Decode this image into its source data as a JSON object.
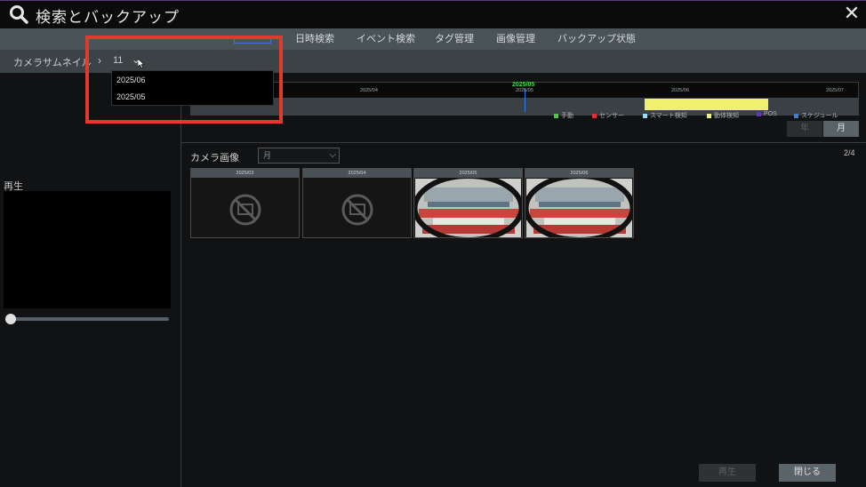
{
  "window": {
    "title": "検索とバックアップ",
    "close_label": "✕"
  },
  "tabs": [
    {
      "label": "日時検索"
    },
    {
      "label": "イベント検索"
    },
    {
      "label": "タグ管理"
    },
    {
      "label": "画像管理"
    },
    {
      "label": "バックアップ状態"
    }
  ],
  "breadcrumb": {
    "label": "カメラサムネイル",
    "arrow": "›",
    "value": "11",
    "chevron": "⌄"
  },
  "dropdown": {
    "options": [
      "2025/06",
      "2025/05"
    ]
  },
  "left": {
    "play_label": "再生"
  },
  "timeline": {
    "current": "2025/05",
    "ticks": [
      "2025/04",
      "2025/05",
      "2025/06",
      "2025/07"
    ],
    "legend": [
      {
        "label": "手動",
        "color": "#3fd03a"
      },
      {
        "label": "センサー",
        "color": "#e03030"
      },
      {
        "label": "スマート検知",
        "color": "#8ee0ff"
      },
      {
        "label": "動体検知",
        "color": "#f1ef6e"
      },
      {
        "label": "POS",
        "color": "#6a2fd0"
      },
      {
        "label": "スケジュール",
        "color": "#3a7de0"
      }
    ],
    "view_buttons": {
      "year": "年",
      "month": "月"
    }
  },
  "camera": {
    "label": "カメラ画像",
    "period_value": "月",
    "page": "2/4",
    "thumbnails": [
      {
        "caption": "2025/03",
        "has_image": false
      },
      {
        "caption": "2025/04",
        "has_image": false
      },
      {
        "caption": "2025/05",
        "has_image": true
      },
      {
        "caption": "2025/06",
        "has_image": true
      }
    ]
  },
  "footer": {
    "play_label": "再生",
    "close_label": "閉じる"
  }
}
